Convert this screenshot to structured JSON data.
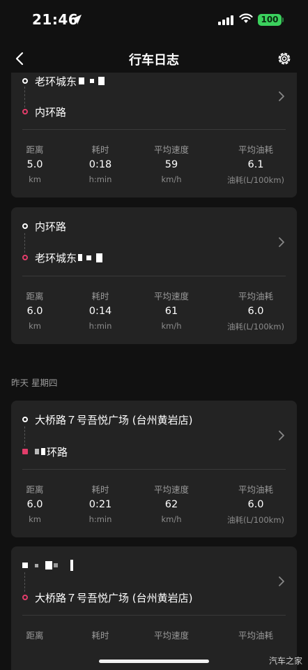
{
  "status": {
    "time": "21:46",
    "battery": "100"
  },
  "header": {
    "title": "行车日志"
  },
  "section": {
    "yesterday": "昨天 星期四"
  },
  "trips": [
    {
      "start": "老环城东",
      "end": "内环路",
      "distance": "5.0",
      "duration": "0:18",
      "avg_speed": "59",
      "fuel": "6.1"
    },
    {
      "start": "内环路",
      "end": "老环城东",
      "distance": "6.0",
      "duration": "0:14",
      "avg_speed": "61",
      "fuel": "6.0"
    },
    {
      "start": "大桥路７号吾悦广场 (台州黄岩店)",
      "end": "环路",
      "distance": "6.0",
      "duration": "0:21",
      "avg_speed": "62",
      "fuel": "6.0"
    },
    {
      "start": "",
      "end": "大桥路７号吾悦广场 (台州黄岩店)"
    }
  ],
  "labels": {
    "distance": "距离",
    "duration": "耗时",
    "avg_speed": "平均速度",
    "fuel": "平均油耗",
    "unit_km": "km",
    "unit_time": "h:min",
    "unit_speed": "km/h",
    "unit_fuel": "油耗(L/100km)"
  },
  "watermark": "汽车之家"
}
